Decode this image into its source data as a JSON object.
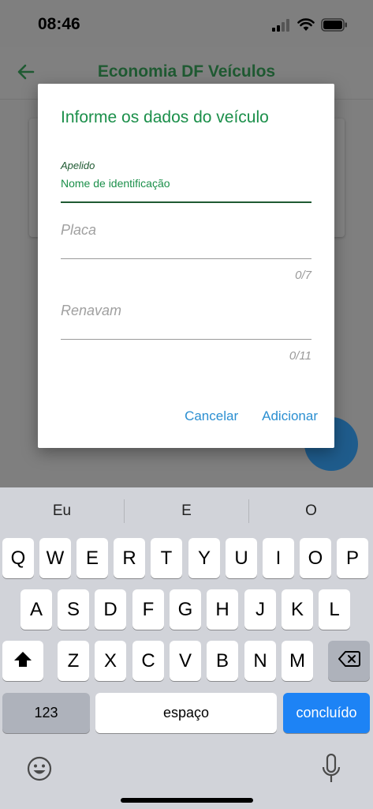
{
  "status_bar": {
    "time": "08:46"
  },
  "app_bar": {
    "title": "Economia DF Veículos"
  },
  "dialog": {
    "title": "Informe os dados do veículo",
    "apelido": {
      "label": "Apelido",
      "placeholder": "Nome de identificação",
      "value": ""
    },
    "placa": {
      "placeholder": "Placa",
      "counter": "0/7",
      "value": ""
    },
    "renavam": {
      "placeholder": "Renavam",
      "counter": "0/11",
      "value": ""
    },
    "cancel_label": "Cancelar",
    "add_label": "Adicionar"
  },
  "colors": {
    "accent_green": "#1b8f4a",
    "dark_green": "#1f5a32",
    "action_blue": "#2b8fd1",
    "keyboard_blue": "#1d83f5"
  },
  "keyboard": {
    "suggestions": [
      "Eu",
      "E",
      "O"
    ],
    "row1": [
      "Q",
      "W",
      "E",
      "R",
      "T",
      "Y",
      "U",
      "I",
      "O",
      "P"
    ],
    "row2": [
      "A",
      "S",
      "D",
      "F",
      "G",
      "H",
      "J",
      "K",
      "L"
    ],
    "row3": [
      "Z",
      "X",
      "C",
      "V",
      "B",
      "N",
      "M"
    ],
    "numbers_label": "123",
    "space_label": "espaço",
    "done_label": "concluído",
    "icons": [
      "shift-icon",
      "backspace-icon",
      "emoji-icon",
      "mic-icon"
    ]
  }
}
